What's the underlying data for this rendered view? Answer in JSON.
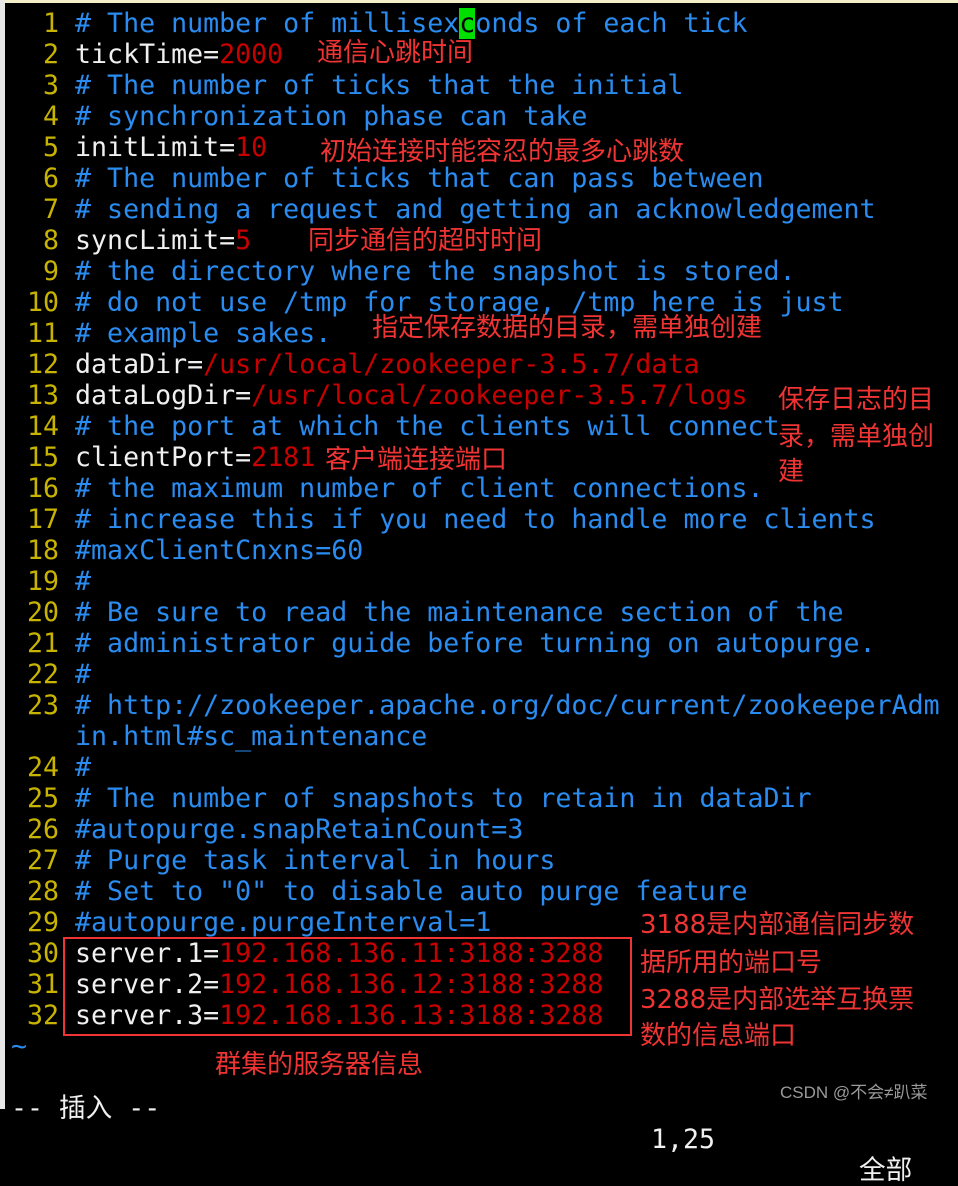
{
  "editor": {
    "cursor": {
      "line": 1,
      "col": 25
    },
    "lines": [
      {
        "num": "1",
        "parts": [
          {
            "t": "# The number of millisex",
            "k": "comment"
          },
          {
            "t": "c",
            "k": "cursor"
          },
          {
            "t": "onds of each tick",
            "k": "comment"
          }
        ]
      },
      {
        "num": "2",
        "parts": [
          {
            "t": "tickTime=",
            "k": "key"
          },
          {
            "t": "2000",
            "k": "val"
          }
        ]
      },
      {
        "num": "3",
        "parts": [
          {
            "t": "# The number of ticks that the initial",
            "k": "comment"
          }
        ]
      },
      {
        "num": "4",
        "parts": [
          {
            "t": "# synchronization phase can take",
            "k": "comment"
          }
        ]
      },
      {
        "num": "5",
        "parts": [
          {
            "t": "initLimit=",
            "k": "key"
          },
          {
            "t": "10",
            "k": "val"
          }
        ]
      },
      {
        "num": "6",
        "parts": [
          {
            "t": "# The number of ticks that can pass between",
            "k": "comment"
          }
        ]
      },
      {
        "num": "7",
        "parts": [
          {
            "t": "# sending a request and getting an acknowledgement",
            "k": "comment"
          }
        ]
      },
      {
        "num": "8",
        "parts": [
          {
            "t": "syncLimit=",
            "k": "key"
          },
          {
            "t": "5",
            "k": "val"
          }
        ]
      },
      {
        "num": "9",
        "parts": [
          {
            "t": "# the directory where the snapshot is stored.",
            "k": "comment"
          }
        ]
      },
      {
        "num": "10",
        "parts": [
          {
            "t": "# do not use /tmp for storage, /tmp here is just",
            "k": "comment"
          }
        ]
      },
      {
        "num": "11",
        "parts": [
          {
            "t": "# example sakes.",
            "k": "comment"
          }
        ]
      },
      {
        "num": "12",
        "parts": [
          {
            "t": "dataDir=",
            "k": "key"
          },
          {
            "t": "/usr/local/zookeeper-3.5.7/data",
            "k": "val"
          }
        ]
      },
      {
        "num": "13",
        "parts": [
          {
            "t": "dataLogDir=",
            "k": "key"
          },
          {
            "t": "/usr/local/zookeeper-3.5.7/logs",
            "k": "val"
          }
        ]
      },
      {
        "num": "14",
        "parts": [
          {
            "t": "# the port at which the clients will connect",
            "k": "comment"
          }
        ]
      },
      {
        "num": "15",
        "parts": [
          {
            "t": "clientPort=",
            "k": "key"
          },
          {
            "t": "2181",
            "k": "val"
          }
        ]
      },
      {
        "num": "16",
        "parts": [
          {
            "t": "# the maximum number of client connections.",
            "k": "comment"
          }
        ]
      },
      {
        "num": "17",
        "parts": [
          {
            "t": "# increase this if you need to handle more clients",
            "k": "comment"
          }
        ]
      },
      {
        "num": "18",
        "parts": [
          {
            "t": "#maxClientCnxns=60",
            "k": "comment"
          }
        ]
      },
      {
        "num": "19",
        "parts": [
          {
            "t": "#",
            "k": "comment"
          }
        ]
      },
      {
        "num": "20",
        "parts": [
          {
            "t": "# Be sure to read the maintenance section of the",
            "k": "comment"
          }
        ]
      },
      {
        "num": "21",
        "parts": [
          {
            "t": "# administrator guide before turning on autopurge.",
            "k": "comment"
          }
        ]
      },
      {
        "num": "22",
        "parts": [
          {
            "t": "#",
            "k": "comment"
          }
        ]
      },
      {
        "num": "23",
        "parts": [
          {
            "t": "# http://zookeeper.apache.org/doc/current/zookeeperAdmin.html#sc_maintenance",
            "k": "comment"
          }
        ]
      },
      {
        "num": "24",
        "parts": [
          {
            "t": "#",
            "k": "comment"
          }
        ]
      },
      {
        "num": "25",
        "parts": [
          {
            "t": "# The number of snapshots to retain in dataDir",
            "k": "comment"
          }
        ]
      },
      {
        "num": "26",
        "parts": [
          {
            "t": "#autopurge.snapRetainCount=3",
            "k": "comment"
          }
        ]
      },
      {
        "num": "27",
        "parts": [
          {
            "t": "# Purge task interval in hours",
            "k": "comment"
          }
        ]
      },
      {
        "num": "28",
        "parts": [
          {
            "t": "# Set to \"0\" to disable auto purge feature",
            "k": "comment"
          }
        ]
      },
      {
        "num": "29",
        "parts": [
          {
            "t": "#autopurge.purgeInterval=1",
            "k": "comment"
          }
        ]
      },
      {
        "num": "30",
        "parts": [
          {
            "t": "server.1=",
            "k": "key"
          },
          {
            "t": "192.168.136.11:3188:3288",
            "k": "val"
          }
        ]
      },
      {
        "num": "31",
        "parts": [
          {
            "t": "server.2=",
            "k": "key"
          },
          {
            "t": "192.168.136.12:3188:3288",
            "k": "val"
          }
        ]
      },
      {
        "num": "32",
        "parts": [
          {
            "t": "server.3=",
            "k": "key"
          },
          {
            "t": "192.168.136.13:3188:3288",
            "k": "val"
          }
        ]
      }
    ],
    "tilde": "~"
  },
  "statusline": {
    "mode": "-- 插入 --",
    "position": "1,25",
    "scroll": "全部"
  },
  "annotations": {
    "tick_time": "通信心跳时间",
    "init_limit": "初始连接时能容忍的最多心跳数",
    "sync_limit": "同步通信的超时时间",
    "data_dir": "指定保存数据的目录，需单独创建",
    "data_log_dir": [
      "保存日志的目",
      "录，需单独创",
      "建"
    ],
    "client_port": "客户端连接端口",
    "ports": [
      "3188是内部通信同步数",
      "据所用的端口号",
      "3288是内部选举互换票",
      "数的信息端口"
    ],
    "cluster": "群集的服务器信息"
  },
  "watermark": "CSDN @不会≠趴菜",
  "colors": {
    "comment": "#2a8cf0",
    "value": "#c80000",
    "line_number": "#c8b400",
    "annotation": "#f03434",
    "cursor": "#00e000"
  }
}
